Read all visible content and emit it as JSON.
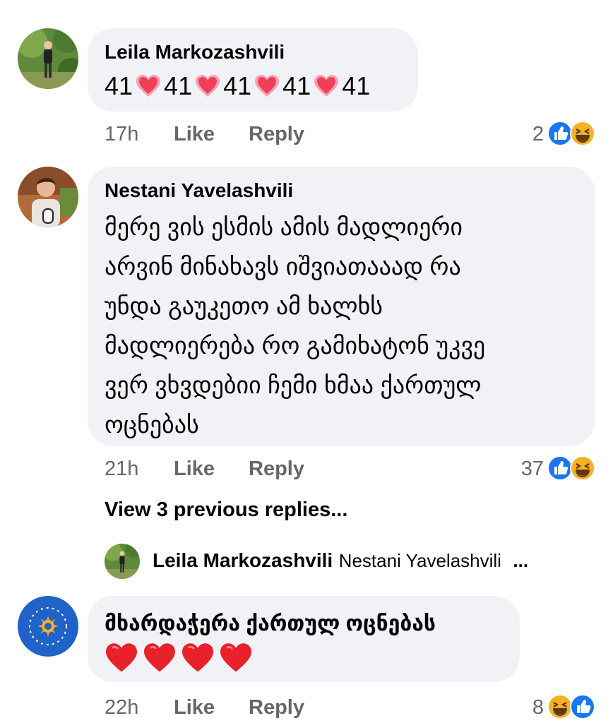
{
  "comments": [
    {
      "author": "Leila Markozashvili",
      "segments": [
        "41",
        "41",
        "41",
        "41",
        "41"
      ],
      "time": "17h",
      "like": "Like",
      "reply": "Reply",
      "reactions_count": "2"
    },
    {
      "author": "Nestani Yavelashvili",
      "lines": [
        "მერე ვის ესმის ამის მადლიერი",
        "არვინ მინახავს იშვიათააად რა",
        "უნდა გაუკეთო ამ ხალხს",
        "მადლიერება რო გამიხატონ უკვე",
        "ვერ ვხვდებიი ჩემი ხმაა ქართულ",
        "ოცნებას"
      ],
      "time": "21h",
      "like": "Like",
      "reply": "Reply",
      "reactions_count": "37"
    },
    {
      "author": "",
      "text": "მხარდაჭერა ქართულ ოცნებას",
      "time": "22h",
      "like": "Like",
      "reply": "Reply",
      "reactions_count": "8"
    }
  ],
  "view_previous": "View 3 previous replies...",
  "reply_preview": {
    "author": "Leila Markozashvili",
    "mention": "Nestani Yavelashvili",
    "ellipsis": "..."
  },
  "colors": {
    "like_blue": "#1877f2",
    "haha_yellow": "#f7b125",
    "heart_red": "#f33e58",
    "bubble": "#f0f2f5",
    "meta_gray": "#65676b"
  },
  "icons": [
    "like-icon",
    "haha-icon",
    "heart-icon"
  ]
}
